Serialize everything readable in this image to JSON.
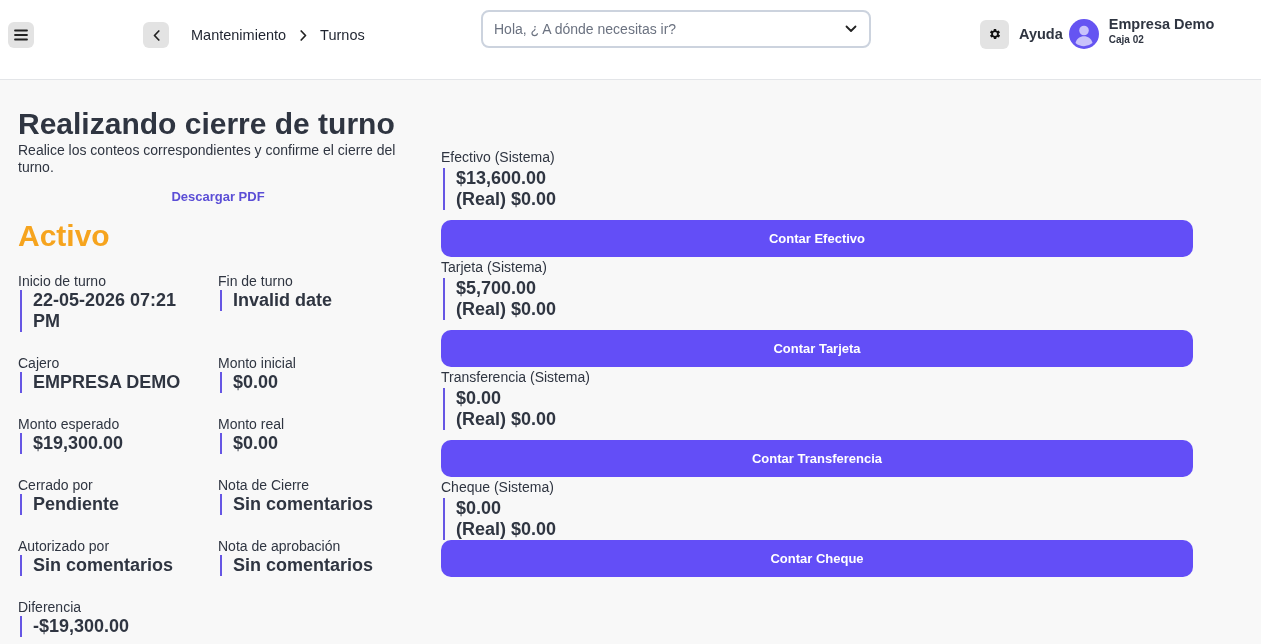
{
  "header": {
    "breadcrumb": [
      "Mantenimiento",
      "Turnos"
    ],
    "search": {
      "placeholder": "Hola, ¿ A dónde necesitas ir?"
    },
    "help_label": "Ayuda",
    "user": {
      "name": "Empresa Demo",
      "subtitle": "Caja 02"
    }
  },
  "page": {
    "title": "Realizando cierre de turno",
    "subtitle": "Realice los conteos correspondientes y confirme el cierre del turno.",
    "download_link": "Descargar PDF",
    "status": "Activo"
  },
  "details": [
    {
      "label": "Inicio de turno",
      "value": "22-05-2026 07:21 PM"
    },
    {
      "label": "Fin de turno",
      "value": "Invalid date"
    },
    {
      "label": "Cajero",
      "value": "EMPRESA DEMO"
    },
    {
      "label": "Monto inicial",
      "value": "$0.00"
    },
    {
      "label": "Monto esperado",
      "value": "$19,300.00"
    },
    {
      "label": "Monto real",
      "value": "$0.00"
    },
    {
      "label": "Cerrado por",
      "value": "Pendiente"
    },
    {
      "label": "Nota de Cierre",
      "value": "Sin comentarios"
    },
    {
      "label": "Autorizado por",
      "value": "Sin comentarios"
    },
    {
      "label": "Nota de aprobación",
      "value": "Sin comentarios"
    },
    {
      "label": "Diferencia",
      "value": "-$19,300.00"
    }
  ],
  "payment_methods": [
    {
      "label": "Efectivo (Sistema)",
      "system_amount": "$13,600.00",
      "real_amount": "(Real) $0.00",
      "button": "Contar Efectivo"
    },
    {
      "label": "Tarjeta (Sistema)",
      "system_amount": "$5,700.00",
      "real_amount": "(Real) $0.00",
      "button": "Contar Tarjeta"
    },
    {
      "label": "Transferencia (Sistema)",
      "system_amount": "$0.00",
      "real_amount": "(Real) $0.00",
      "button": "Contar Transferencia"
    },
    {
      "label": "Cheque (Sistema)",
      "system_amount": "$0.00",
      "real_amount": "(Real) $0.00",
      "button": "Contar Cheque"
    }
  ]
}
